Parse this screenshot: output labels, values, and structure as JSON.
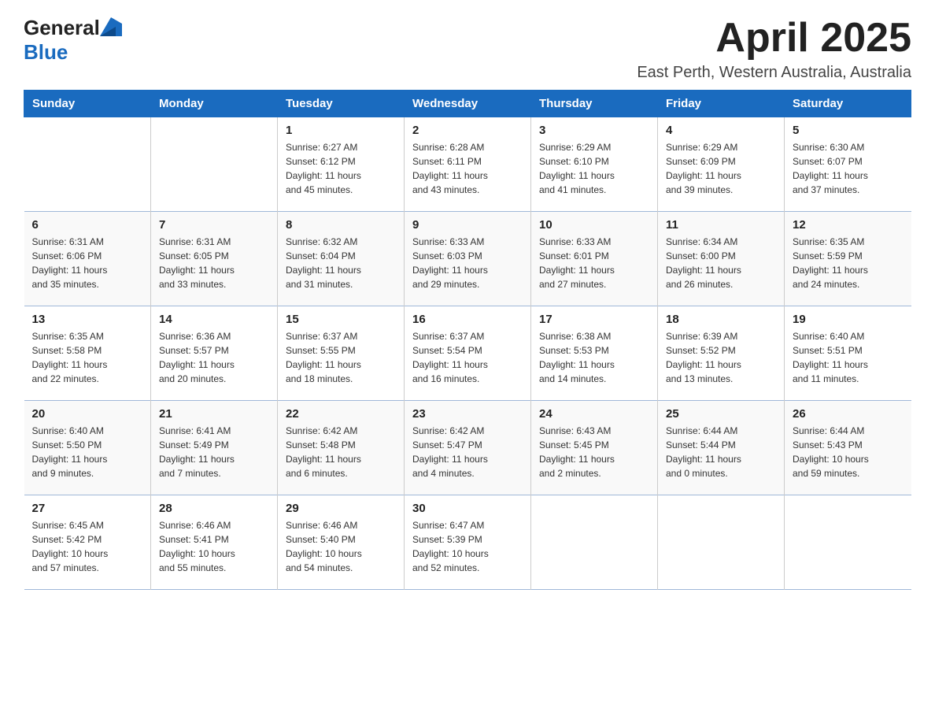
{
  "logo": {
    "general": "General",
    "blue": "Blue"
  },
  "title": "April 2025",
  "location": "East Perth, Western Australia, Australia",
  "weekdays": [
    "Sunday",
    "Monday",
    "Tuesday",
    "Wednesday",
    "Thursday",
    "Friday",
    "Saturday"
  ],
  "weeks": [
    [
      {
        "day": "",
        "info": ""
      },
      {
        "day": "",
        "info": ""
      },
      {
        "day": "1",
        "info": "Sunrise: 6:27 AM\nSunset: 6:12 PM\nDaylight: 11 hours\nand 45 minutes."
      },
      {
        "day": "2",
        "info": "Sunrise: 6:28 AM\nSunset: 6:11 PM\nDaylight: 11 hours\nand 43 minutes."
      },
      {
        "day": "3",
        "info": "Sunrise: 6:29 AM\nSunset: 6:10 PM\nDaylight: 11 hours\nand 41 minutes."
      },
      {
        "day": "4",
        "info": "Sunrise: 6:29 AM\nSunset: 6:09 PM\nDaylight: 11 hours\nand 39 minutes."
      },
      {
        "day": "5",
        "info": "Sunrise: 6:30 AM\nSunset: 6:07 PM\nDaylight: 11 hours\nand 37 minutes."
      }
    ],
    [
      {
        "day": "6",
        "info": "Sunrise: 6:31 AM\nSunset: 6:06 PM\nDaylight: 11 hours\nand 35 minutes."
      },
      {
        "day": "7",
        "info": "Sunrise: 6:31 AM\nSunset: 6:05 PM\nDaylight: 11 hours\nand 33 minutes."
      },
      {
        "day": "8",
        "info": "Sunrise: 6:32 AM\nSunset: 6:04 PM\nDaylight: 11 hours\nand 31 minutes."
      },
      {
        "day": "9",
        "info": "Sunrise: 6:33 AM\nSunset: 6:03 PM\nDaylight: 11 hours\nand 29 minutes."
      },
      {
        "day": "10",
        "info": "Sunrise: 6:33 AM\nSunset: 6:01 PM\nDaylight: 11 hours\nand 27 minutes."
      },
      {
        "day": "11",
        "info": "Sunrise: 6:34 AM\nSunset: 6:00 PM\nDaylight: 11 hours\nand 26 minutes."
      },
      {
        "day": "12",
        "info": "Sunrise: 6:35 AM\nSunset: 5:59 PM\nDaylight: 11 hours\nand 24 minutes."
      }
    ],
    [
      {
        "day": "13",
        "info": "Sunrise: 6:35 AM\nSunset: 5:58 PM\nDaylight: 11 hours\nand 22 minutes."
      },
      {
        "day": "14",
        "info": "Sunrise: 6:36 AM\nSunset: 5:57 PM\nDaylight: 11 hours\nand 20 minutes."
      },
      {
        "day": "15",
        "info": "Sunrise: 6:37 AM\nSunset: 5:55 PM\nDaylight: 11 hours\nand 18 minutes."
      },
      {
        "day": "16",
        "info": "Sunrise: 6:37 AM\nSunset: 5:54 PM\nDaylight: 11 hours\nand 16 minutes."
      },
      {
        "day": "17",
        "info": "Sunrise: 6:38 AM\nSunset: 5:53 PM\nDaylight: 11 hours\nand 14 minutes."
      },
      {
        "day": "18",
        "info": "Sunrise: 6:39 AM\nSunset: 5:52 PM\nDaylight: 11 hours\nand 13 minutes."
      },
      {
        "day": "19",
        "info": "Sunrise: 6:40 AM\nSunset: 5:51 PM\nDaylight: 11 hours\nand 11 minutes."
      }
    ],
    [
      {
        "day": "20",
        "info": "Sunrise: 6:40 AM\nSunset: 5:50 PM\nDaylight: 11 hours\nand 9 minutes."
      },
      {
        "day": "21",
        "info": "Sunrise: 6:41 AM\nSunset: 5:49 PM\nDaylight: 11 hours\nand 7 minutes."
      },
      {
        "day": "22",
        "info": "Sunrise: 6:42 AM\nSunset: 5:48 PM\nDaylight: 11 hours\nand 6 minutes."
      },
      {
        "day": "23",
        "info": "Sunrise: 6:42 AM\nSunset: 5:47 PM\nDaylight: 11 hours\nand 4 minutes."
      },
      {
        "day": "24",
        "info": "Sunrise: 6:43 AM\nSunset: 5:45 PM\nDaylight: 11 hours\nand 2 minutes."
      },
      {
        "day": "25",
        "info": "Sunrise: 6:44 AM\nSunset: 5:44 PM\nDaylight: 11 hours\nand 0 minutes."
      },
      {
        "day": "26",
        "info": "Sunrise: 6:44 AM\nSunset: 5:43 PM\nDaylight: 10 hours\nand 59 minutes."
      }
    ],
    [
      {
        "day": "27",
        "info": "Sunrise: 6:45 AM\nSunset: 5:42 PM\nDaylight: 10 hours\nand 57 minutes."
      },
      {
        "day": "28",
        "info": "Sunrise: 6:46 AM\nSunset: 5:41 PM\nDaylight: 10 hours\nand 55 minutes."
      },
      {
        "day": "29",
        "info": "Sunrise: 6:46 AM\nSunset: 5:40 PM\nDaylight: 10 hours\nand 54 minutes."
      },
      {
        "day": "30",
        "info": "Sunrise: 6:47 AM\nSunset: 5:39 PM\nDaylight: 10 hours\nand 52 minutes."
      },
      {
        "day": "",
        "info": ""
      },
      {
        "day": "",
        "info": ""
      },
      {
        "day": "",
        "info": ""
      }
    ]
  ]
}
